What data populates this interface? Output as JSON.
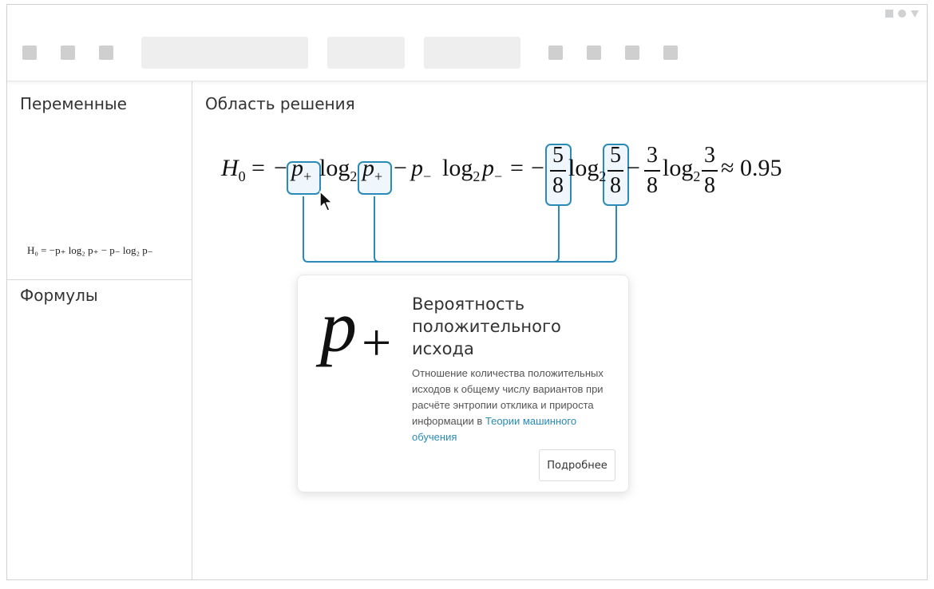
{
  "sidebar": {
    "variables_title": "Переменные",
    "formulas_title": "Формулы"
  },
  "main": {
    "title": "Область решения"
  },
  "equation": {
    "lhs": "H",
    "lhs_sub": "0",
    "approx_value": "≈ 0.95",
    "frac_5_8_num": "5",
    "frac_5_8_den": "8",
    "frac_3_8_num": "3",
    "frac_3_8_den": "8"
  },
  "formula_list": {
    "item_1": "H₀ = −p₊ log₂ p₊ − p₋ log₂ p₋"
  },
  "tooltip": {
    "symbol": "p",
    "symbol_sub": "+",
    "title": "Вероятность положительного исхода",
    "description": "Отношение количества положительных исходов к общему числу вариантов при расчёте энтропии отклика и прироста информации в ",
    "link_text": "Теории машинного обучения",
    "button_label": "Подробнее"
  },
  "colors": {
    "accent": "#2a8ab8",
    "placeholder": "#cfcfcf"
  }
}
